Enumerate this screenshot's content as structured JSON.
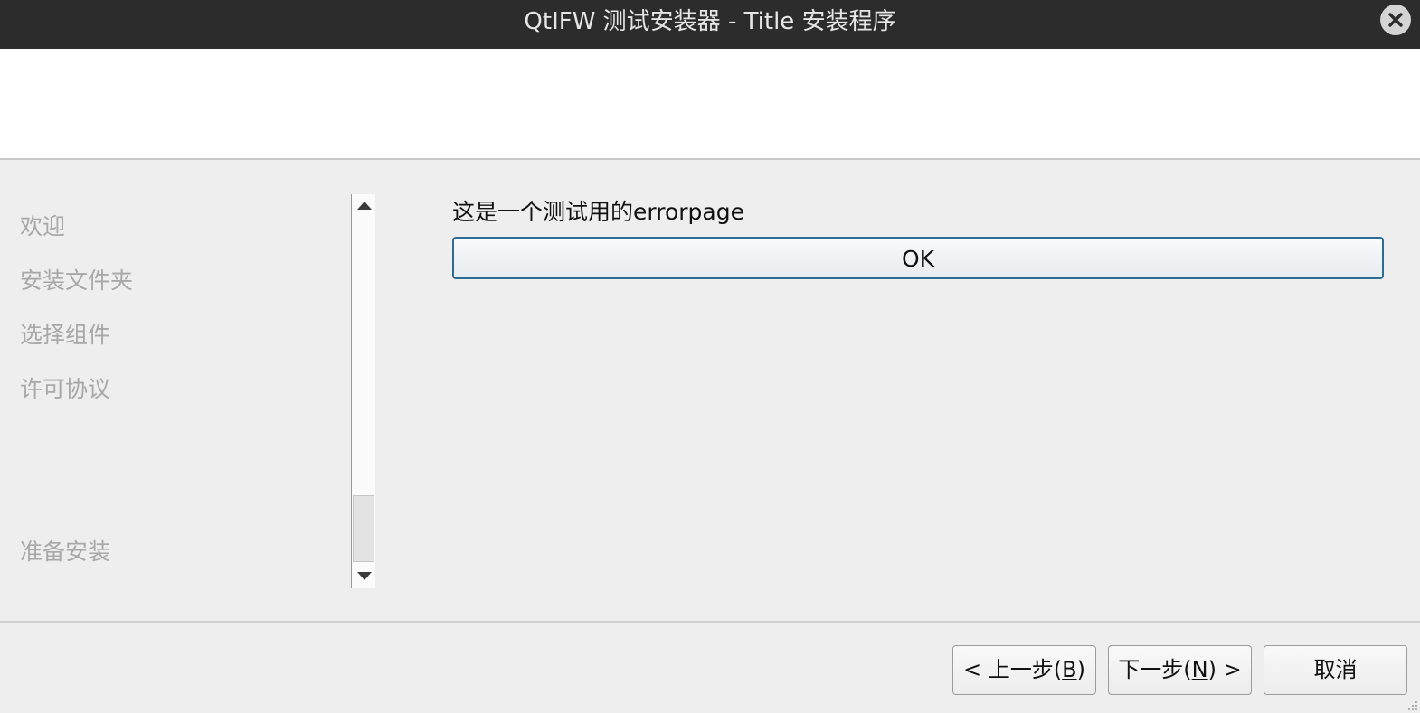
{
  "window": {
    "title": "QtIFW 测试安装器 - Title 安装程序",
    "close_icon": "close-icon"
  },
  "sidebar": {
    "steps": [
      {
        "label": "欢迎"
      },
      {
        "label": "安装文件夹"
      },
      {
        "label": "选择组件"
      },
      {
        "label": "许可协议"
      },
      {
        "label": "准备安装"
      }
    ],
    "scrollbar": {
      "up_icon": "chevron-up-icon",
      "down_icon": "chevron-down-icon",
      "scroll_position": 0.76
    }
  },
  "page": {
    "heading": "这是一个测试用的errorpage",
    "ok_label": "OK"
  },
  "footer": {
    "back": {
      "prefix": "< 上一步(",
      "mnemonic": "B",
      "suffix": ")"
    },
    "next": {
      "prefix": "下一步(",
      "mnemonic": "N",
      "suffix": ") >"
    },
    "cancel": "取消"
  },
  "colors": {
    "titlebar": "#2c2c2c",
    "background": "#eeeeee",
    "accent_border": "#2c6b94",
    "disabled_text": "#a8a8a8"
  }
}
